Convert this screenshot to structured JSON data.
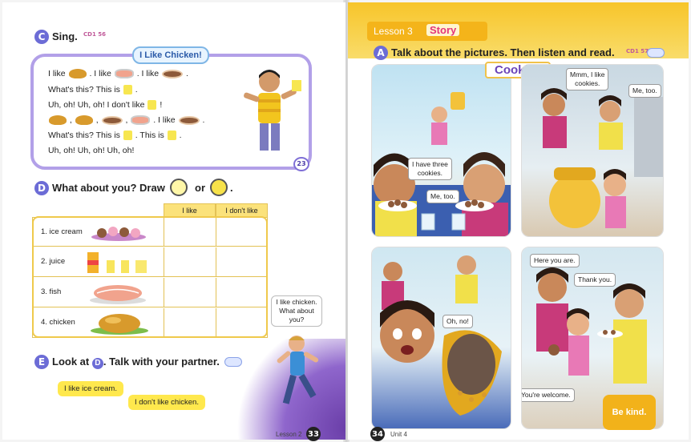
{
  "left_page": {
    "section_c": {
      "letter": "C",
      "title": "Sing.",
      "track": "CD1\n56"
    },
    "song": {
      "title": "I Like Chicken!",
      "line1": [
        "I like",
        ". I like",
        ". I like",
        "."
      ],
      "line2": [
        "What's this? This is",
        "."
      ],
      "line3": [
        "Uh, oh! Uh, oh! I don't like",
        "!"
      ],
      "line4": [
        ",",
        ",",
        ",",
        ". I like",
        "."
      ],
      "line5": [
        "What's this? This is",
        ". This is",
        "."
      ],
      "line6": "Uh, oh! Uh, oh! Uh, oh!",
      "sticker": "23"
    },
    "section_d": {
      "letter": "D",
      "title": "What about you? Draw",
      "or": "or",
      "end": "."
    },
    "table": {
      "headers": [
        "I like",
        "I don't like"
      ],
      "rows": [
        {
          "label": "1. ice cream"
        },
        {
          "label": "2. juice"
        },
        {
          "label": "3. fish"
        },
        {
          "label": "4. chicken"
        }
      ]
    },
    "kid_bubble": "I like chicken.\nWhat about\nyou?",
    "section_e": {
      "letter": "E",
      "title_pre": "Look at",
      "ref": "D",
      "title_post": ". Talk with your partner."
    },
    "bubble1": "I like ice cream.",
    "bubble2": "I don't like chicken.",
    "footer_label": "Lesson 2",
    "page_number": "33"
  },
  "right_page": {
    "lesson_label": "Lesson 3",
    "story_label": "Story",
    "section_a": {
      "letter": "A",
      "title": "Talk about the pictures. Then listen and read.",
      "track": "CD1\n57"
    },
    "story_title": "Cookies",
    "panel1": {
      "bubble1": "I have three\ncookies.",
      "bubble2": "Me, too."
    },
    "panel2": {
      "bubble1": "Mmm, I like\ncookies.",
      "bubble2": "Me, too."
    },
    "panel3": {
      "bubble1": "Oh, no!"
    },
    "panel4": {
      "bubble1": "Here you are.",
      "bubble2": "Thank you.",
      "bubble3": "You're welcome."
    },
    "value_badge": "Be kind.",
    "page_number": "34",
    "footer_label": "Unit 4"
  },
  "colors": {
    "section_badge": "#6c6cd6",
    "header_yellow": "#f7c52a",
    "story_pink": "#e4347a",
    "title_purple": "#6a44b8"
  }
}
